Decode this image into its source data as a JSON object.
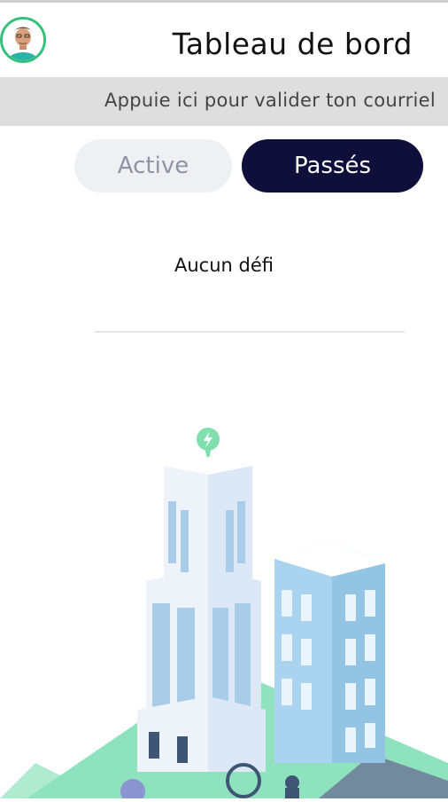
{
  "header": {
    "title": "Tableau de bord"
  },
  "banner": {
    "text": "Appuie ici pour valider ton courriel"
  },
  "tabs": [
    {
      "label": "Active"
    },
    {
      "label": "Passés"
    }
  ],
  "empty_state": {
    "text": "Aucun défi"
  },
  "icons": {
    "avatar": "user-avatar",
    "pin": "lightning-pin-icon"
  },
  "colors": {
    "accent": "#0e0f3b",
    "avatar_ring": "#33c07a",
    "banner_bg": "#dedede",
    "ground": "#8ee3be",
    "building": "#a9d3ee"
  }
}
